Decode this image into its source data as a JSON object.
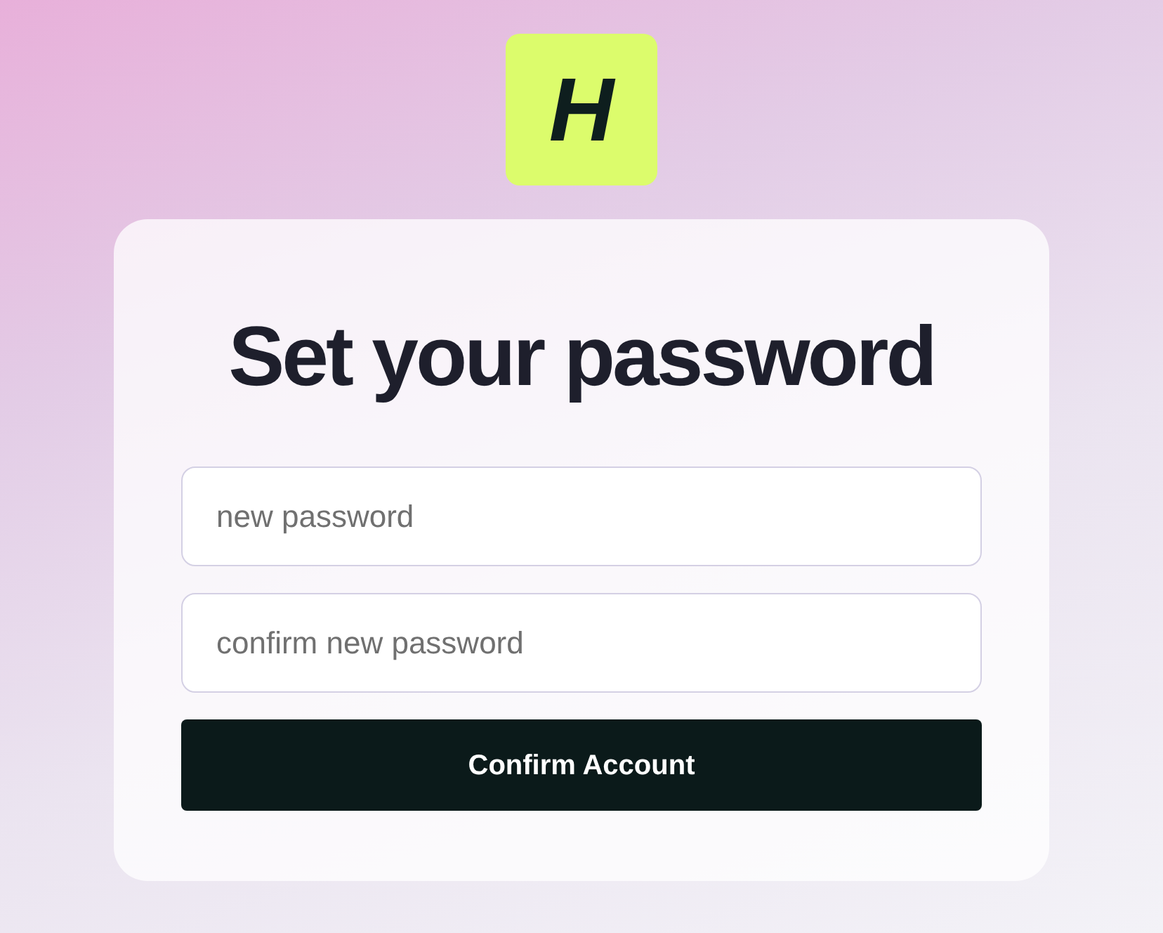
{
  "logo": {
    "text": "H"
  },
  "title": "Set your password",
  "fields": [
    {
      "placeholder": "new password"
    },
    {
      "placeholder": "confirm new password"
    }
  ],
  "button": "Confirm Account"
}
